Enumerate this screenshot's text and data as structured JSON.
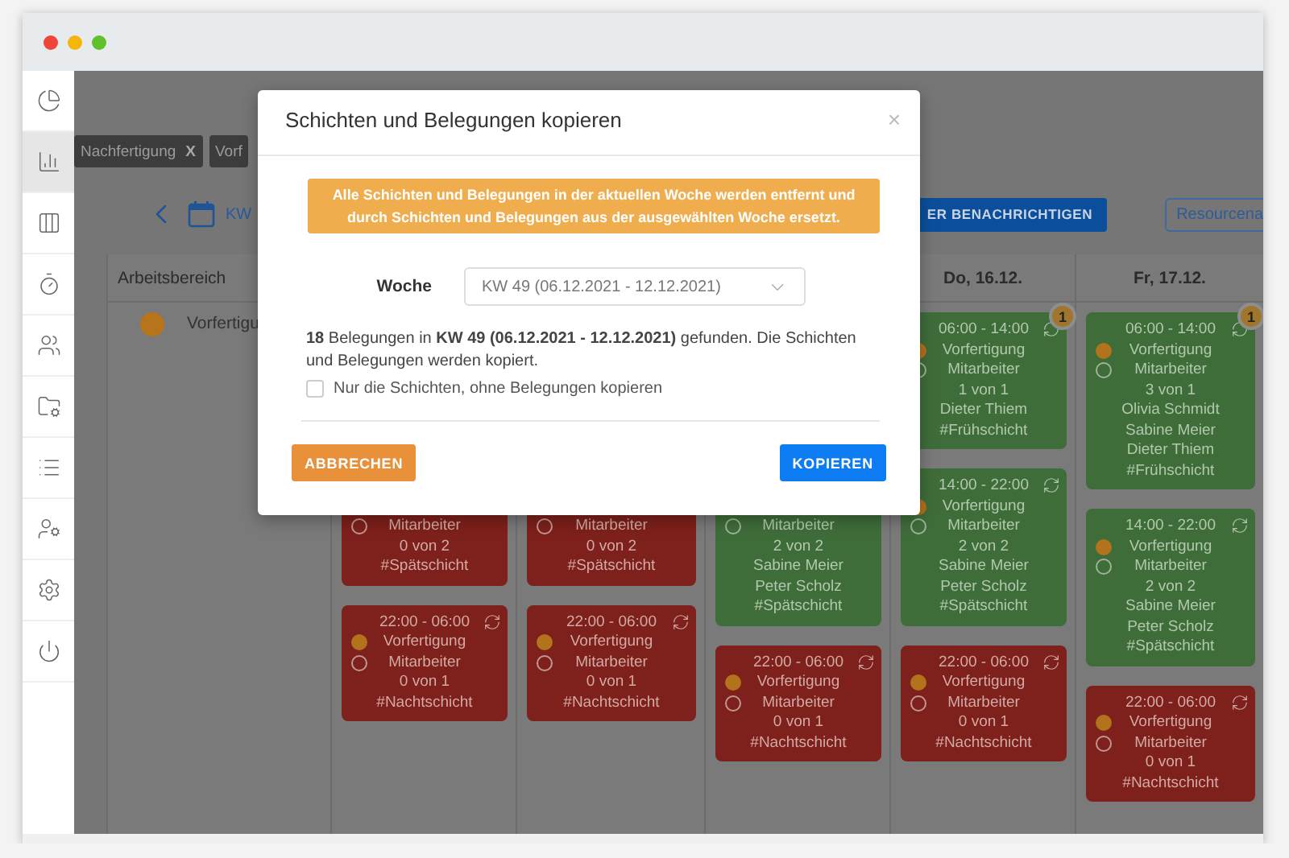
{
  "sidebar": {
    "items": [
      {
        "selected": false
      },
      {
        "selected": true
      },
      {
        "selected": false
      },
      {
        "selected": false
      },
      {
        "selected": false
      },
      {
        "selected": false
      },
      {
        "selected": false
      },
      {
        "selected": false
      },
      {
        "selected": false
      },
      {
        "selected": false
      }
    ]
  },
  "filters": [
    {
      "label": "Nachfertigung",
      "close": "X"
    },
    {
      "label": "Vorf"
    }
  ],
  "nav": {
    "week": "KW",
    "notify_button": "ER BENACHRICHTIGEN",
    "resource_button": "Resourcena"
  },
  "table": {
    "first_column": "Arbeitsbereich",
    "area": {
      "name": "Vorfertigu",
      "color": "#b8741a"
    },
    "days": [
      {
        "cards": [
          {
            "cut_top": true,
            "staffed": false,
            "role": "Mitarbeiter",
            "count": "0 von 2",
            "tag": "#Spätschicht"
          },
          {
            "staffed": false,
            "time": "22:00 - 06:00",
            "area": "Vorfertigung",
            "role": "Mitarbeiter",
            "count": "0 von 1",
            "tag": "#Nachtschicht"
          }
        ]
      },
      {
        "cards": [
          {
            "cut_top": true,
            "staffed": false,
            "role": "Mitarbeiter",
            "count": "0 von 2",
            "tag": "#Spätschicht"
          },
          {
            "staffed": false,
            "time": "22:00 - 06:00",
            "area": "Vorfertigung",
            "role": "Mitarbeiter",
            "count": "0 von 1",
            "tag": "#Nachtschicht"
          }
        ]
      },
      {
        "cards": [
          {
            "cut_top": true,
            "staffed": true,
            "role": "Mitarbeiter",
            "count": "2 von 2",
            "names": [
              "Sabine Meier",
              "Peter Scholz"
            ],
            "tag": "#Spätschicht"
          },
          {
            "staffed": false,
            "time": "22:00 - 06:00",
            "area": "Vorfertigung",
            "role": "Mitarbeiter",
            "count": "0 von 1",
            "tag": "#Nachtschicht"
          }
        ]
      },
      {
        "header": "Do, 16.12.",
        "cards": [
          {
            "staffed": true,
            "badge": "1",
            "time": "06:00 - 14:00",
            "area": "Vorfertigung",
            "role": "Mitarbeiter",
            "count": "1 von 1",
            "names": [
              "Dieter Thiem"
            ],
            "tag": "#Frühschicht"
          },
          {
            "staffed": true,
            "time": "14:00 - 22:00",
            "area": "Vorfertigung",
            "role": "Mitarbeiter",
            "count": "2 von 2",
            "names": [
              "Sabine Meier",
              "Peter Scholz"
            ],
            "tag": "#Spätschicht"
          },
          {
            "staffed": false,
            "time": "22:00 - 06:00",
            "area": "Vorfertigung",
            "role": "Mitarbeiter",
            "count": "0 von 1",
            "tag": "#Nachtschicht"
          }
        ]
      },
      {
        "header": "Fr, 17.12.",
        "cards": [
          {
            "staffed": true,
            "badge": "1",
            "time": "06:00 - 14:00",
            "area": "Vorfertigung",
            "role": "Mitarbeiter",
            "count": "3 von 1",
            "names": [
              "Olivia Schmidt",
              "Sabine Meier",
              "Dieter Thiem"
            ],
            "tag": "#Frühschicht"
          },
          {
            "staffed": true,
            "time": "14:00 - 22:00",
            "area": "Vorfertigung",
            "role": "Mitarbeiter",
            "count": "2 von 2",
            "names": [
              "Sabine Meier",
              "Peter Scholz"
            ],
            "tag": "#Spätschicht"
          },
          {
            "staffed": false,
            "time": "22:00 - 06:00",
            "area": "Vorfertigung",
            "role": "Mitarbeiter",
            "count": "0 von 1",
            "tag": "#Nachtschicht"
          }
        ]
      }
    ]
  },
  "dialog": {
    "title": "Schichten und Belegungen kopieren",
    "close": "×",
    "warning": "Alle Schichten und Belegungen in der aktuellen Woche werden entfernt und durch Schichten und Belegungen aus der ausgewählten Woche ersetzt.",
    "week_label": "Woche",
    "week_value": "KW 49 (06.12.2021 - 12.12.2021)",
    "info": "**18** Belegungen in **KW 49 (06.12.2021 - 12.12.2021)** gefunden. Die Schichten und Belegungen werden kopiert.",
    "only_shifts": {
      "label": "Nur die Schichten, ohne Belegungen kopieren",
      "checked": false
    },
    "cancel": "ABBRECHEN",
    "confirm": "KOPIEREN"
  }
}
